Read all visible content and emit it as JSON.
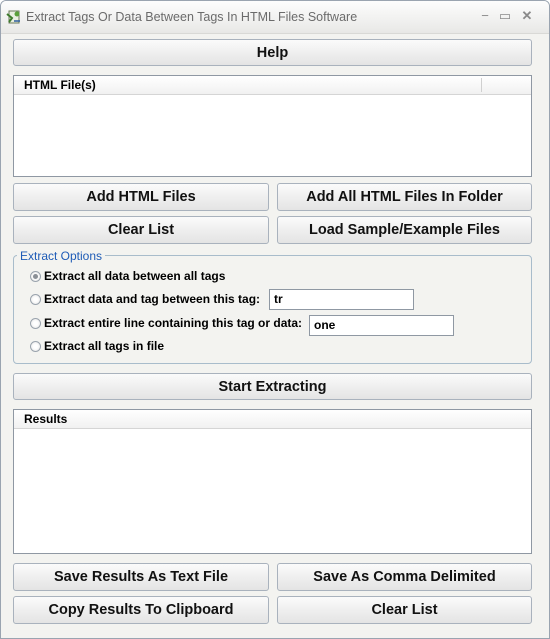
{
  "window": {
    "title": "Extract Tags Or Data Between Tags In HTML Files Software",
    "minimize_glyph": "−",
    "maximize_glyph": "▭",
    "close_glyph": "✕"
  },
  "buttons": {
    "help": "Help",
    "add_html_files": "Add HTML Files",
    "add_all_html_files_in_folder": "Add All HTML Files In Folder",
    "clear_list": "Clear List",
    "load_sample": "Load Sample/Example Files",
    "start_extracting": "Start Extracting",
    "save_text": "Save Results As Text File",
    "save_comma": "Save As Comma Delimited",
    "copy_clipboard": "Copy Results To Clipboard",
    "clear_results": "Clear List"
  },
  "file_list": {
    "column_header": "HTML File(s)",
    "rows": []
  },
  "extract_options": {
    "title": "Extract Options",
    "selected_index": 0,
    "options": [
      {
        "label": "Extract all data between all tags"
      },
      {
        "label": "Extract data and tag between this tag:",
        "input_value": "tr"
      },
      {
        "label": "Extract entire line containing this tag or data:",
        "input_value": "one"
      },
      {
        "label": "Extract all tags in file"
      }
    ]
  },
  "results": {
    "column_header": "Results",
    "rows": []
  }
}
